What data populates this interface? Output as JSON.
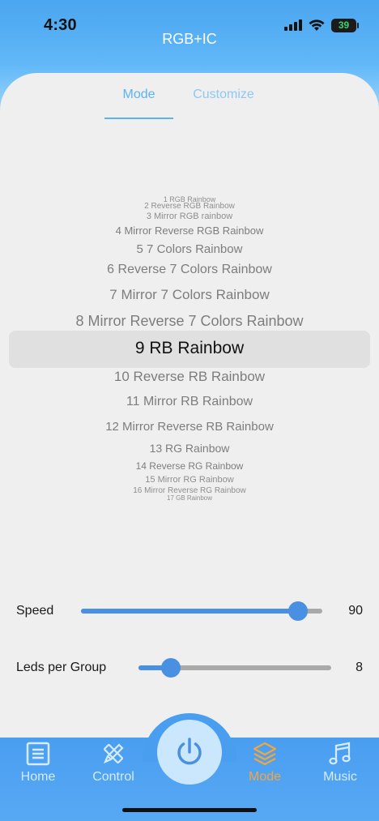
{
  "status_bar": {
    "time": "4:30",
    "battery": "39"
  },
  "header": {
    "title": "RGB+IC"
  },
  "tabs": [
    {
      "label": "Mode",
      "active": true
    },
    {
      "label": "Customize",
      "active": false
    }
  ],
  "mode_list": {
    "selected_index": 8,
    "items": [
      "1  RGB Rainbow",
      "2  Reverse RGB Rainbow",
      "3  Mirror RGB rainbow",
      "4  Mirror Reverse RGB Rainbow",
      "5  7 Colors Rainbow",
      "6  Reverse 7 Colors Rainbow",
      "7  Mirror 7 Colors Rainbow",
      "8  Mirror Reverse 7 Colors Rainbow",
      "9  RB Rainbow",
      "10  Reverse RB Rainbow",
      "11  Mirror RB Rainbow",
      "12  Mirror Reverse RB Rainbow",
      "13  RG Rainbow",
      "14  Reverse RG Rainbow",
      "15  Mirror RG Rainbow",
      "16  Mirror Reverse RG Rainbow",
      "17  GB Rainbow"
    ]
  },
  "sliders": [
    {
      "label": "Speed",
      "value": "90",
      "fraction": 0.9
    },
    {
      "label": "Leds per Group",
      "value": "8",
      "fraction": 0.17
    }
  ],
  "tabbar": {
    "items": [
      {
        "label": "Home",
        "icon": "home-list-icon",
        "active": false
      },
      {
        "label": "Control",
        "icon": "pencil-ruler-icon",
        "active": false
      },
      {
        "label": "Mode",
        "icon": "layers-icon",
        "active": true
      },
      {
        "label": "Music",
        "icon": "music-note-icon",
        "active": false
      }
    ],
    "power_icon": "power-icon"
  },
  "colors": {
    "accent": "#4a90e2",
    "tab_active": "#5bb3f3",
    "tabbar_active": "#f5a53c",
    "tabbar_inactive": "#d6ebff"
  }
}
